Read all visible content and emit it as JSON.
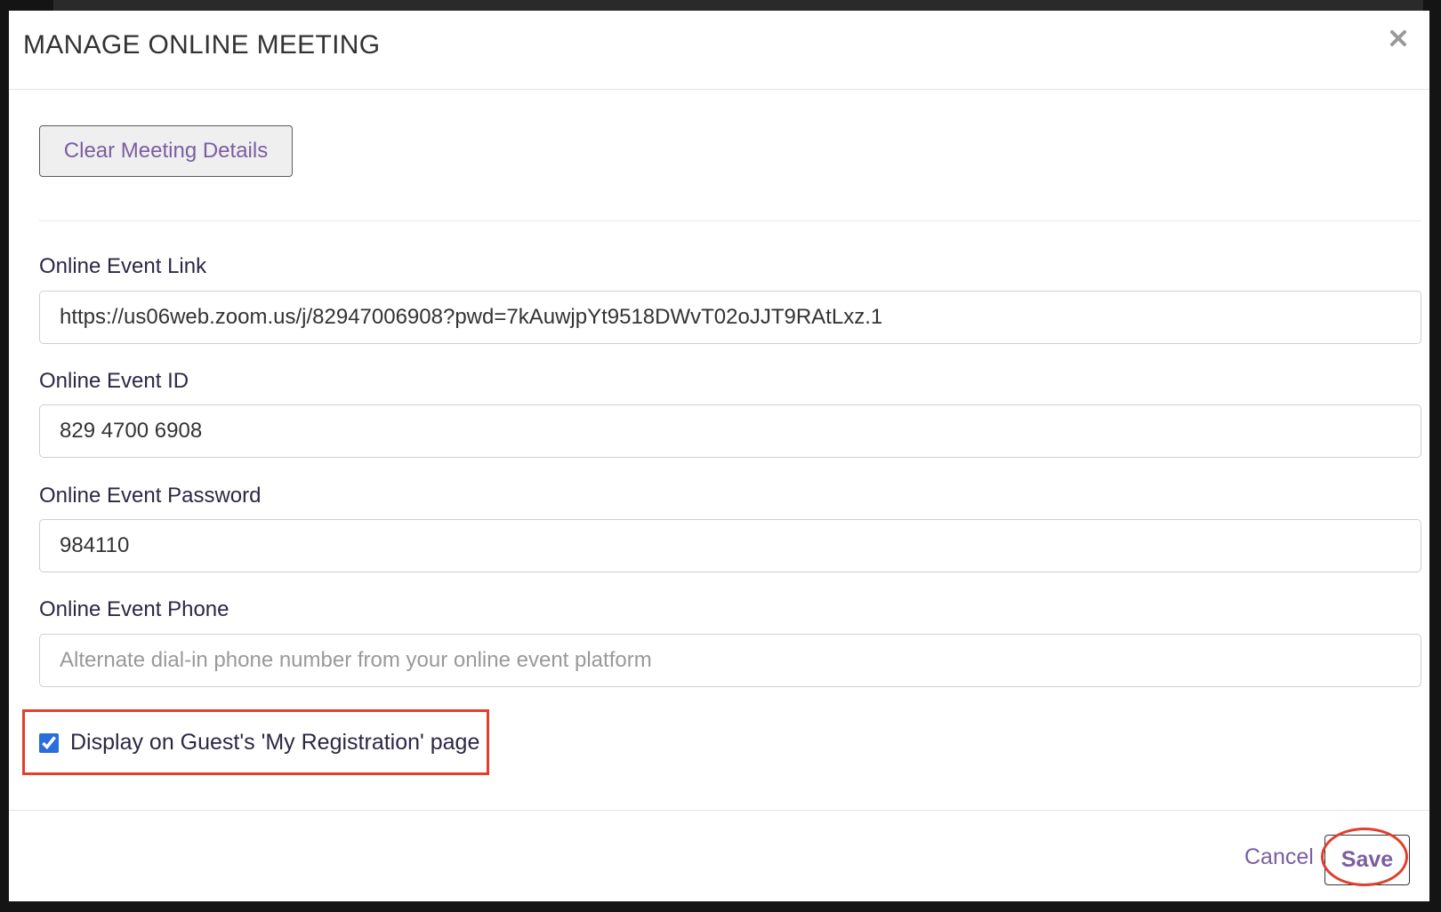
{
  "modal": {
    "title": "MANAGE ONLINE MEETING",
    "close_icon": "close-icon"
  },
  "actions": {
    "clear_label": "Clear Meeting Details"
  },
  "fields": {
    "link": {
      "label": "Online Event Link",
      "value": "https://us06web.zoom.us/j/82947006908?pwd=7kAuwjpYt9518DWvT02oJJT9RAtLxz.1"
    },
    "id": {
      "label": "Online Event ID",
      "value": "829 4700 6908"
    },
    "password": {
      "label": "Online Event Password",
      "value": "984110"
    },
    "phone": {
      "label": "Online Event Phone",
      "placeholder": "Alternate dial-in phone number from your online event platform"
    }
  },
  "display_option": {
    "label": "Display on Guest's 'My Registration' page",
    "checked": true
  },
  "footer": {
    "cancel_label": "Cancel",
    "save_label": "Save"
  },
  "colors": {
    "accent": "#7b5ea1",
    "highlight": "#e0402e",
    "checkbox": "#2a6edb"
  }
}
